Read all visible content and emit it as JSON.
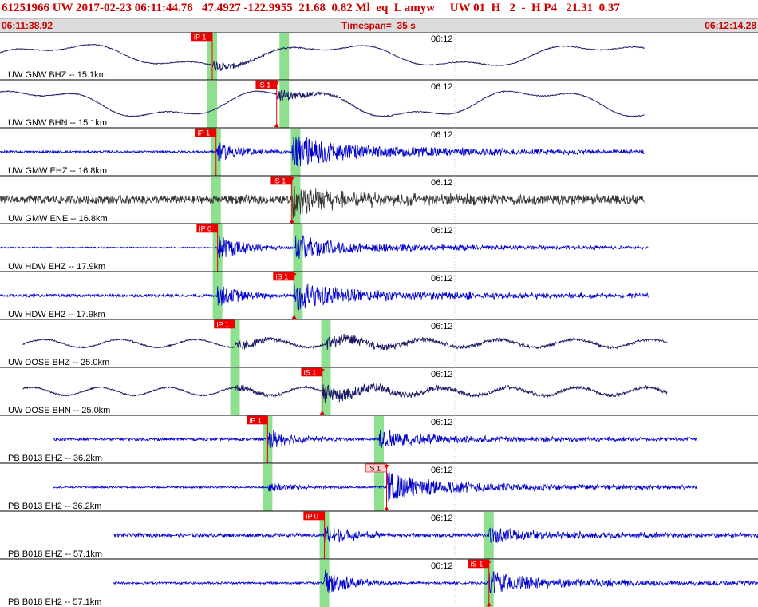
{
  "header": {
    "title": "61251966 UW 2017-02-23 06:11:44.76   47.4927 -122.9955  21.68  0.82 Ml  eq  L amyw     UW 01  H   2  -  H P4   21.31  0.37",
    "start_time": "06:11:38.92",
    "timespan_label": "Timespan=",
    "timespan_value": "35 s",
    "end_time": "06:12:14.28"
  },
  "time_tick_label": "06:12",
  "colors": {
    "trace_blue": "#0000cc",
    "trace_dark": "#333333",
    "trace_navy": "#1a1a66",
    "pick_box": "#ee0000",
    "pick_box_light": "#ffcccc",
    "pick_window": "#8ee08e",
    "title_red": "#cc0000"
  },
  "traces": [
    {
      "label": "UW GNW BHZ -- 15.1km",
      "color": "navy",
      "style": "long",
      "noise": 0.02,
      "amp": 0.55,
      "start": 0.0,
      "end": 0.85,
      "periods": [
        [
          0.35,
          0.8
        ],
        [
          0.12,
          0.3
        ]
      ],
      "onset": 0.28,
      "onsetAmp": 0.25,
      "pick": {
        "text": "iP 1",
        "at": 0.28,
        "type": "P"
      },
      "windows": [
        0.28,
        0.375
      ]
    },
    {
      "label": "UW GNW BHN -- 15.1km",
      "color": "navy",
      "style": "long",
      "noise": 0.02,
      "amp": 0.6,
      "start": 0.0,
      "end": 0.85,
      "periods": [
        [
          0.33,
          0.9
        ],
        [
          0.11,
          0.3
        ]
      ],
      "onset": 0.365,
      "onsetAmp": 0.3,
      "pick": {
        "text": "iS 1",
        "at": 0.365,
        "type": "S"
      },
      "windows": [
        0.28,
        0.375
      ]
    },
    {
      "label": "UW GMW EHZ -- 16.8km",
      "color": "blue",
      "style": "hf",
      "noise": 0.05,
      "amp": 0.0,
      "start": 0.0,
      "end": 0.85,
      "periods": [],
      "onset": 0.285,
      "onsetAmp": 0.45,
      "onset2": 0.385,
      "onset2Amp": 0.85,
      "pick": {
        "text": "iP 1",
        "at": 0.285,
        "type": "P"
      },
      "windows": [
        0.285,
        0.39
      ]
    },
    {
      "label": "UW GMW ENE -- 16.8km",
      "color": "dark",
      "style": "hf",
      "noise": 0.18,
      "amp": 0.0,
      "start": 0.0,
      "end": 0.85,
      "periods": [],
      "onset": 0.285,
      "onsetAmp": 0.1,
      "onset2": 0.385,
      "onset2Amp": 0.7,
      "pick": {
        "text": "iS 1",
        "at": 0.385,
        "type": "S"
      },
      "windows": [
        0.285,
        0.39
      ]
    },
    {
      "label": "UW HDW EHZ -- 17.9km",
      "color": "blue",
      "style": "hf",
      "noise": 0.03,
      "amp": 0.0,
      "start": 0.0,
      "end": 0.855,
      "periods": [],
      "onset": 0.287,
      "onsetAmp": 0.6,
      "onset2": 0.39,
      "onset2Amp": 0.6,
      "pick": {
        "text": "iP 0",
        "at": 0.287,
        "type": "P"
      },
      "windows": [
        0.287,
        0.393
      ]
    },
    {
      "label": "UW HDW EH2 -- 17.9km",
      "color": "blue",
      "style": "hf",
      "noise": 0.06,
      "amp": 0.0,
      "start": 0.0,
      "end": 0.855,
      "periods": [],
      "onset": 0.287,
      "onsetAmp": 0.5,
      "onset2": 0.388,
      "onset2Amp": 0.75,
      "pick": {
        "text": "iS 1",
        "at": 0.388,
        "type": "S"
      },
      "windows": [
        0.287,
        0.393
      ]
    },
    {
      "label": "UW DOSE BHZ -- 25.0km",
      "color": "navy",
      "style": "long",
      "noise": 0.03,
      "amp": 0.32,
      "start": 0.03,
      "end": 0.88,
      "periods": [
        [
          0.1,
          0.55
        ]
      ],
      "onset": 0.31,
      "onsetAmp": 0.3,
      "onset2": 0.43,
      "onset2Amp": 0.35,
      "pick": {
        "text": "iP 1",
        "at": 0.31,
        "type": "P"
      },
      "windows": [
        0.31,
        0.43
      ]
    },
    {
      "label": "UW DOSE BHN -- 25.0km",
      "color": "navy",
      "style": "long",
      "noise": 0.03,
      "amp": 0.3,
      "start": 0.03,
      "end": 0.88,
      "periods": [
        [
          0.09,
          0.6
        ]
      ],
      "onset": 0.31,
      "onsetAmp": 0.2,
      "onset2": 0.425,
      "onset2Amp": 0.45,
      "pick": {
        "text": "iS 1",
        "at": 0.425,
        "type": "S"
      },
      "windows": [
        0.31,
        0.43
      ]
    },
    {
      "label": "PB B013 EHZ -- 36.2km",
      "color": "blue",
      "style": "hf",
      "noise": 0.06,
      "amp": 0.0,
      "start": 0.07,
      "end": 0.92,
      "periods": [],
      "onset": 0.353,
      "onsetAmp": 0.5,
      "onset2": 0.5,
      "onset2Amp": 0.45,
      "pick": {
        "text": "iP 1",
        "at": 0.353,
        "type": "P"
      },
      "windows": [
        0.353,
        0.5
      ]
    },
    {
      "label": "PB B013 EH2 -- 36.2km",
      "color": "blue",
      "style": "hf",
      "noise": 0.04,
      "amp": 0.0,
      "start": 0.07,
      "end": 0.92,
      "periods": [],
      "onset": 0.353,
      "onsetAmp": 0.25,
      "onset2": 0.51,
      "onset2Amp": 0.7,
      "pick": {
        "text": "iS 1",
        "at": 0.51,
        "type": "Slight"
      },
      "windows": [
        0.353,
        0.5
      ]
    },
    {
      "label": "PB B018 EHZ -- 57.1km",
      "color": "blue",
      "style": "hf",
      "noise": 0.08,
      "amp": 0.0,
      "start": 0.15,
      "end": 1.0,
      "periods": [],
      "onset": 0.428,
      "onsetAmp": 0.5,
      "onset2": 0.645,
      "onset2Amp": 0.4,
      "pick": {
        "text": "iP 0",
        "at": 0.428,
        "type": "P"
      },
      "windows": [
        0.428,
        0.645
      ]
    },
    {
      "label": "PB B018 EH2 -- 57.1km",
      "color": "blue",
      "style": "hf",
      "noise": 0.05,
      "amp": 0.0,
      "start": 0.15,
      "end": 1.0,
      "periods": [],
      "onset": 0.428,
      "onsetAmp": 0.6,
      "onset2": 0.645,
      "onset2Amp": 0.55,
      "pick": {
        "text": "iS 1",
        "at": 0.645,
        "type": "S"
      },
      "windows": [
        0.428,
        0.645
      ]
    }
  ]
}
